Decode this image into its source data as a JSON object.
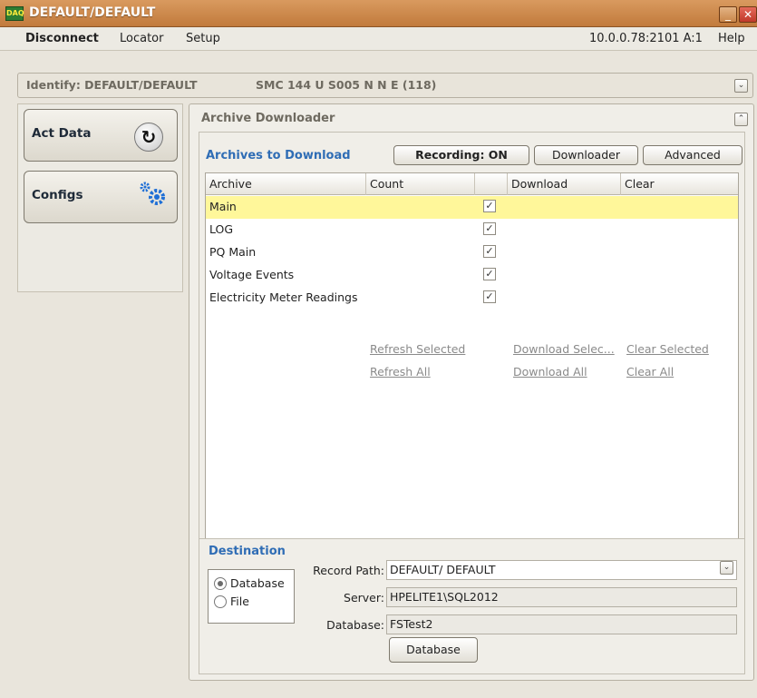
{
  "window": {
    "logo_text": "DAQ",
    "title": "DEFAULT/DEFAULT",
    "minimize_glyph": "_",
    "close_glyph": "✕"
  },
  "menu": {
    "disconnect": "Disconnect",
    "locator": "Locator",
    "setup": "Setup",
    "address": "10.0.0.78:2101 A:1",
    "help": "Help"
  },
  "identify": {
    "text": "Identify: DEFAULT/DEFAULT",
    "model": "SMC 144 U S005 N N E (118)"
  },
  "nav": {
    "act_data": "Act Data",
    "configs": "Configs"
  },
  "main": {
    "title": "Archive Downloader",
    "section_title": "Archives to Download",
    "recording_button": "Recording: ON",
    "downloader_button": "Downloader",
    "advanced_button": "Advanced",
    "columns": {
      "archive": "Archive",
      "count": "Count",
      "check": "",
      "download": "Download",
      "clear": "Clear"
    },
    "rows": [
      {
        "name": "Main",
        "checked": "✓"
      },
      {
        "name": "LOG",
        "checked": "✓"
      },
      {
        "name": "PQ Main",
        "checked": "✓"
      },
      {
        "name": "Voltage Events",
        "checked": "✓"
      },
      {
        "name": "Electricity Meter Readings",
        "checked": "✓"
      }
    ],
    "links": {
      "refresh_selected": "Refresh Selected",
      "refresh_all": "Refresh All",
      "download_selected": "Download Selec...",
      "download_all": "Download All",
      "clear_selected": "Clear Selected",
      "clear_all": "Clear All"
    }
  },
  "destination": {
    "title": "Destination",
    "radio_database": "Database",
    "radio_file": "File",
    "selected": "Database",
    "record_path_label": "Record Path:",
    "record_path_value": "DEFAULT/ DEFAULT",
    "server_label": "Server:",
    "server_value": "HPELITE1\\SQL2012",
    "database_label": "Database:",
    "database_value": "FSTest2",
    "database_button": "Database"
  },
  "colors": {
    "title_bar": "#c98644",
    "section_title": "#2f6db5",
    "selected_row": "#fff79a",
    "link": "#8a8a8a"
  }
}
